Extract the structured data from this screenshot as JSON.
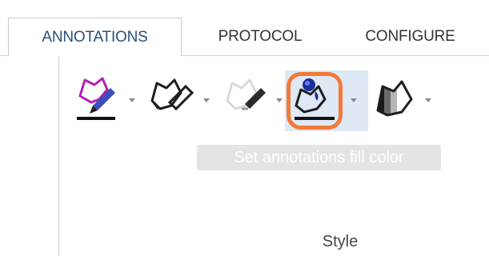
{
  "tabs": {
    "annotations": "ANNOTATIONS",
    "protocol": "PROTOCOL",
    "configure": "CONFIGURE"
  },
  "toolbar": {
    "tooltip": "Set annotations fill color",
    "group_label": "Style",
    "tools": [
      {
        "name": "annotation-color",
        "icon": "pen-color-icon"
      },
      {
        "name": "line-style",
        "icon": "line-style-icon"
      },
      {
        "name": "line-opacity",
        "icon": "opacity-icon"
      },
      {
        "name": "fill-color",
        "icon": "fill-color-icon",
        "active": true
      },
      {
        "name": "fill-opacity",
        "icon": "fill-opacity-icon"
      }
    ]
  },
  "colors": {
    "accent": "#f27a37",
    "active_tab_text": "#2b4f7a",
    "highlight": "#dfe8f5"
  }
}
